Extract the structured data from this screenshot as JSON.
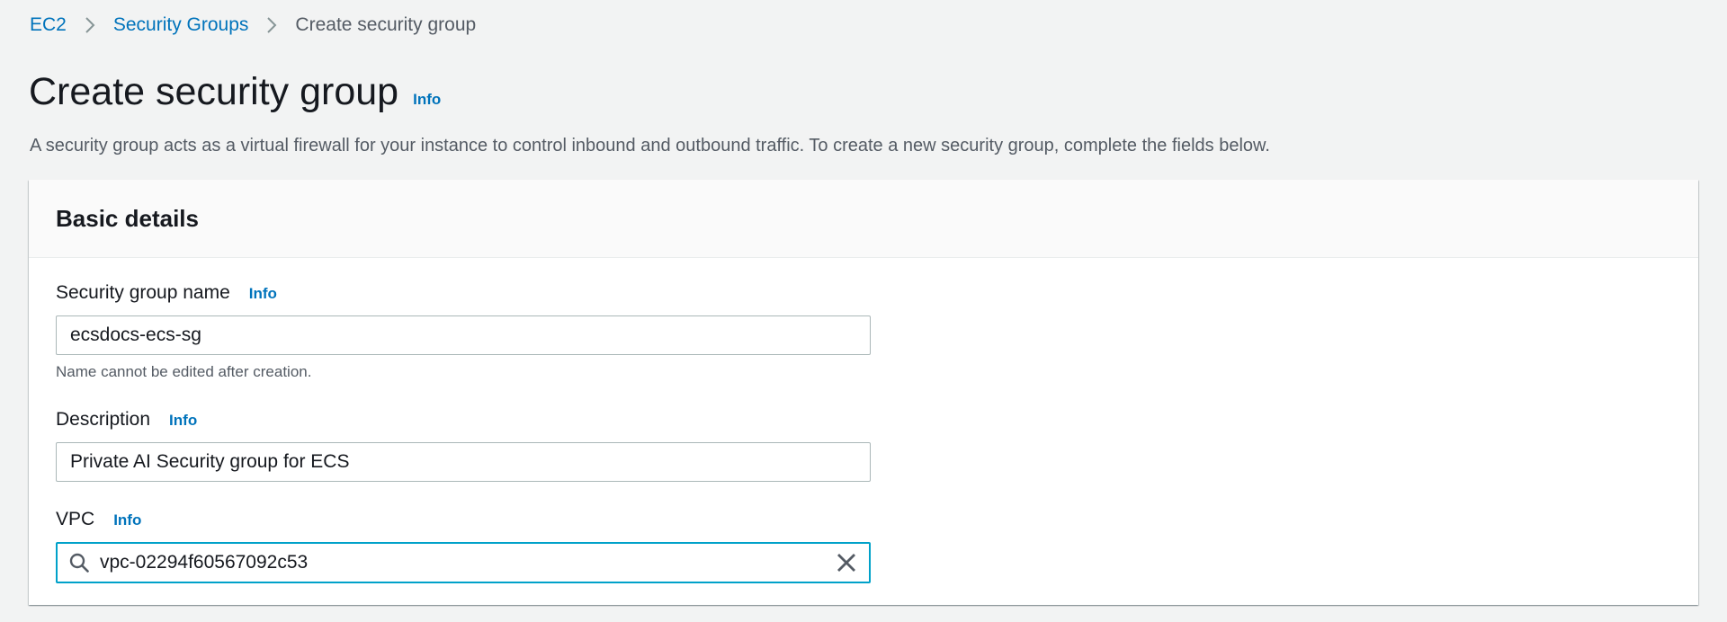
{
  "breadcrumb": {
    "items": [
      "EC2",
      "Security Groups"
    ],
    "current": "Create security group"
  },
  "header": {
    "title": "Create security group",
    "info_label": "Info",
    "description": "A security group acts as a virtual firewall for your instance to control inbound and outbound traffic. To create a new security group, complete the fields below."
  },
  "basic_details": {
    "title": "Basic details",
    "name_field": {
      "label": "Security group name",
      "info_label": "Info",
      "value": "ecsdocs-ecs-sg",
      "hint": "Name cannot be edited after creation."
    },
    "description_field": {
      "label": "Description",
      "info_label": "Info",
      "value": "Private AI Security group for ECS"
    },
    "vpc_field": {
      "label": "VPC",
      "info_label": "Info",
      "value": "vpc-02294f60567092c53"
    }
  },
  "icons": {
    "breadcrumb_separator": "chevron-right-icon",
    "search": "search-icon",
    "clear": "close-icon"
  },
  "colors": {
    "link": "#0073bb",
    "focus_border": "#00a1c9",
    "background": "#f2f3f3"
  }
}
